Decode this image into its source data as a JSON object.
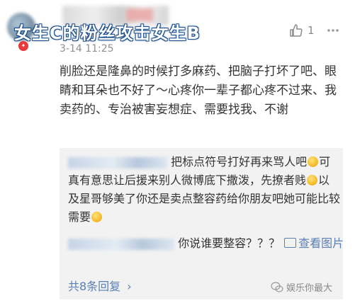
{
  "post": {
    "overlay_title": "女生C的粉丝攻击女生B",
    "like_count": "1",
    "timestamp": "3-14 11:25",
    "comment_text": "削脸还是隆鼻的时候打多麻药、把脑子打坏了吧、眼睛和耳朵也不好了～心疼你一辈子都心疼不过来、我卖药的、专治被害妄想症、需要找我、不谢"
  },
  "replies": [
    {
      "text_parts": [
        "把标点符号打好再来骂人吧",
        "可真有意思让后援来别人微博底下撒泼，先撩者贱",
        "以及星哥够美了你还是卖点整容药给你朋友吧她可能比较需要"
      ]
    },
    {
      "text": "你说谁要整容？？？",
      "view_image": "查看图片"
    }
  ],
  "footer": {
    "replies_count_label": "共8条回复",
    "chevron": "›"
  },
  "watermark": "娱乐你最大",
  "icons": [
    "thumbs-up-icon",
    "more-dots-icon",
    "image-icon",
    "smile-emoji-icon",
    "chevron-right-icon",
    "wechat-icon"
  ],
  "colors": {
    "link": "#5b7fb7",
    "reply_bg": "#f2f2f2",
    "overlay_text": "#ffffff",
    "overlay_outline": "#1e4f8a",
    "badge": "#e8393a"
  }
}
